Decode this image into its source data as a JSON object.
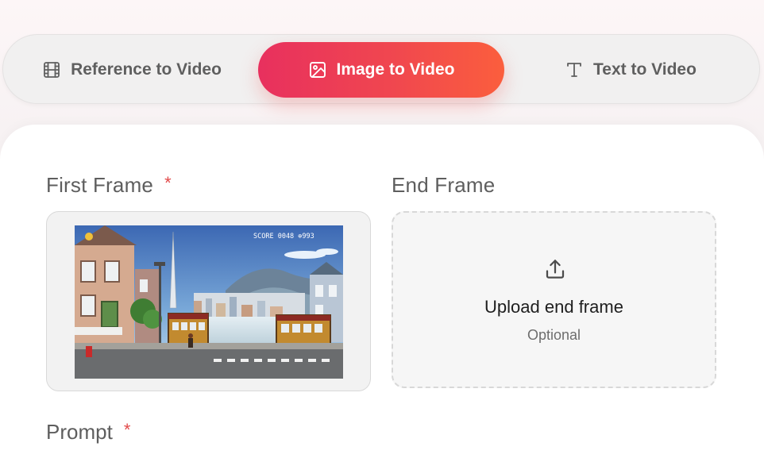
{
  "mode_tabs": [
    {
      "label": "Reference to Video",
      "icon": "film-icon",
      "active": false
    },
    {
      "label": "Image to Video",
      "icon": "image-icon",
      "active": true
    },
    {
      "label": "Text to Video",
      "icon": "text-icon",
      "active": false
    }
  ],
  "colors": {
    "active_gradient_start": "#e8305e",
    "active_gradient_end": "#fb5e3d",
    "required_star": "#e24a4a"
  },
  "first_frame": {
    "title": "First Frame",
    "required_mark": "*",
    "image_caption": "SCORE 0048 ⊕993"
  },
  "end_frame": {
    "title": "End Frame",
    "upload_label": "Upload end frame",
    "optional_label": "Optional",
    "icon": "upload-icon"
  },
  "next_section": {
    "title": "Prompt",
    "required_mark": "*"
  }
}
